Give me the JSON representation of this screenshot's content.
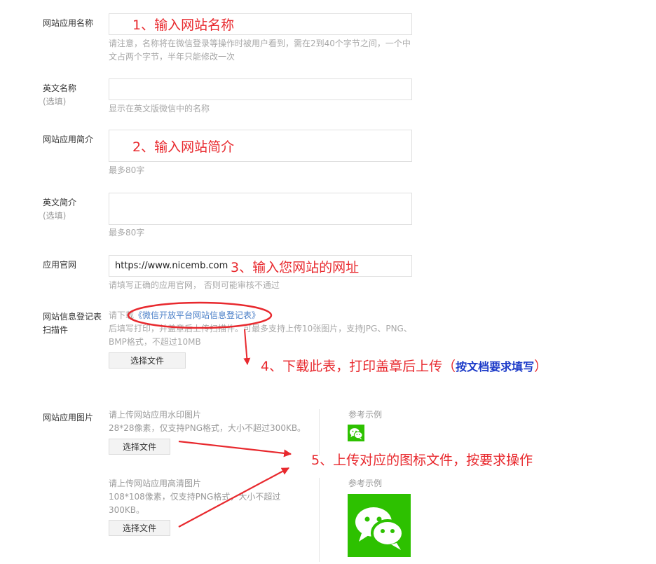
{
  "form": {
    "app_name": {
      "label": "网站应用名称",
      "hint": "请注意，名称将在微信登录等操作时被用户看到，需在2到40个字节之间，一个中文占两个字节，半年只能修改一次"
    },
    "en_name": {
      "label": "英文名称",
      "optional": "(选填)",
      "hint": "显示在英文版微信中的名称"
    },
    "app_intro": {
      "label": "网站应用简介",
      "hint": "最多80字"
    },
    "en_intro": {
      "label": "英文简介",
      "optional": "(选填)",
      "hint": "最多80字"
    },
    "website": {
      "label": "应用官网",
      "value": "https://www.nicemb.com",
      "hint": "请填写正确的应用官网， 否则可能审核不通过"
    },
    "register_form": {
      "label_line1": "网站信息登记表",
      "label_line2": "扫描件",
      "pre_link": "请下载",
      "link": "《微信开放平台网站信息登记表》",
      "hint_line1": "后填写打印，并盖章后上传扫描件。可最多支持上传10张图片，支持JPG、PNG、",
      "hint_line2": "BMP格式，不超过10MB",
      "button": "选择文件"
    },
    "app_images": {
      "label": "网站应用图片",
      "watermark": {
        "title": "请上传网站应用水印图片",
        "spec": "28*28像素，仅支持PNG格式，大小不超过300KB。",
        "button": "选择文件",
        "example_label": "参考示例"
      },
      "hd": {
        "title": "请上传网站应用高清图片",
        "spec_line1": "108*108像素，仅支持PNG格式，大小不超过",
        "spec_line2": "300KB。",
        "button": "选择文件",
        "example_label": "参考示例"
      }
    }
  },
  "annotations": {
    "a1": "1、输入网站名称",
    "a2": "2、输入网站简介",
    "a3": "3、输入您网站的网址",
    "a4_main": "4、下载此表，打印盖章后上传",
    "a4_paren_open": "（",
    "a4_bold": "按文档要求填写",
    "a4_paren_close": "）",
    "a5": "5、上传对应的图标文件，按要求操作"
  },
  "colors": {
    "annotation_red": "#e8292e",
    "wechat_green": "#2dc100",
    "link_blue": "#4a7fc8"
  }
}
